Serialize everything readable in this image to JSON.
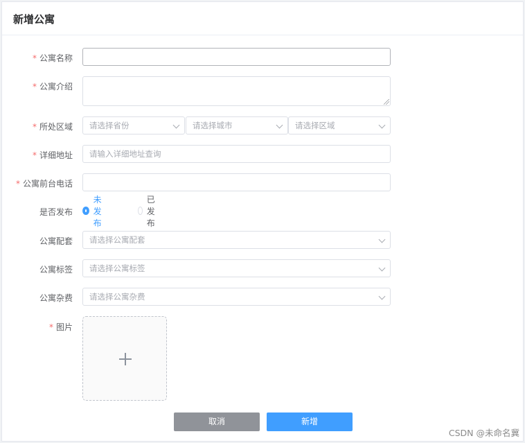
{
  "header": {
    "title": "新增公寓"
  },
  "form": {
    "name": {
      "label": "公寓名称",
      "required": "*",
      "value": ""
    },
    "intro": {
      "label": "公寓介绍",
      "required": "*",
      "value": ""
    },
    "region": {
      "label": "所处区域",
      "required": "*",
      "province_placeholder": "请选择省份",
      "city_placeholder": "请选择城市",
      "district_placeholder": "请选择区域"
    },
    "address": {
      "label": "详细地址",
      "required": "*",
      "placeholder": "请输入详细地址查询"
    },
    "phone": {
      "label": "公寓前台电话",
      "required": "*",
      "value": ""
    },
    "publish": {
      "label": "是否发布",
      "options": [
        "未发布",
        "已发布"
      ],
      "selected": "未发布"
    },
    "facilities": {
      "label": "公寓配套",
      "placeholder": "请选择公寓配套"
    },
    "tags": {
      "label": "公寓标签",
      "placeholder": "请选择公寓标签"
    },
    "fees": {
      "label": "公寓杂费",
      "placeholder": "请选择公寓杂费"
    },
    "images": {
      "label": "图片",
      "required": "*"
    }
  },
  "actions": {
    "cancel_label": "取消",
    "submit_label": "新增"
  },
  "watermark": "CSDN @未命名冀",
  "colors": {
    "primary": "#409eff",
    "required": "#f56c6c",
    "cancel": "#909399"
  },
  "icons": [
    "chevron-down-icon",
    "plus-icon",
    "resize-handle-icon"
  ]
}
